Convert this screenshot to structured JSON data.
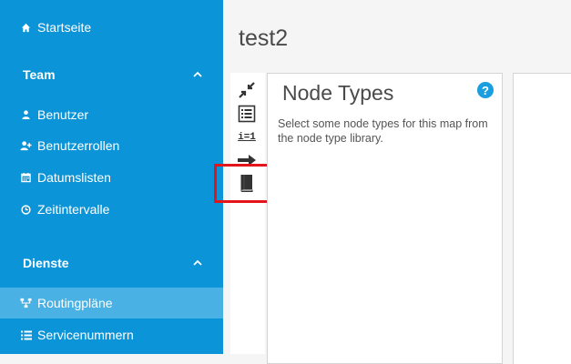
{
  "sidebar": {
    "top_item": {
      "label": "Startseite",
      "icon": "home-icon"
    },
    "sections": [
      {
        "title": "Team",
        "items": [
          {
            "label": "Benutzer",
            "icon": "user-icon"
          },
          {
            "label": "Benutzerrollen",
            "icon": "user-plus-icon"
          },
          {
            "label": "Datumslisten",
            "icon": "calendar-icon"
          },
          {
            "label": "Zeitintervalle",
            "icon": "clock-icon"
          }
        ]
      },
      {
        "title": "Dienste",
        "items": [
          {
            "label": "Routingpläne",
            "icon": "routing-icon",
            "active": true
          },
          {
            "label": "Servicenummern",
            "icon": "list-icon"
          }
        ]
      }
    ]
  },
  "main": {
    "title": "test2",
    "toolbar": {
      "mapping_label": "i=1"
    },
    "panel": {
      "title": "Node Types",
      "help_label": "?",
      "description": "Select some node types for this map from the node type library."
    }
  },
  "colors": {
    "sidebar_bg": "#0b94d7",
    "sidebar_active": "#49b1e3",
    "highlight": "#e3151b",
    "help_button": "#1a9ee0"
  }
}
